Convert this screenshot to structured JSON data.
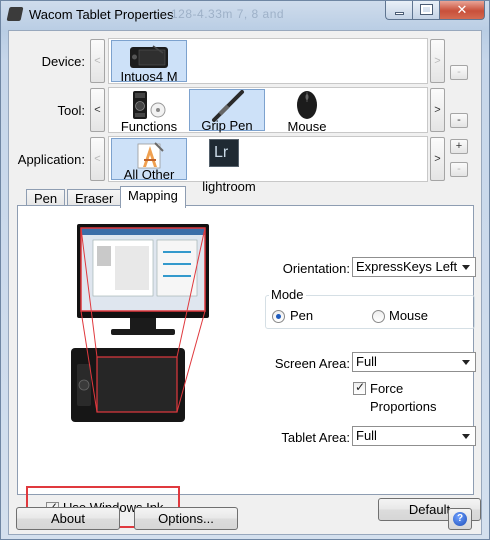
{
  "window": {
    "title": "Wacom Tablet Properties",
    "background_ghost_text": "128-4.33m 7, 8 and",
    "buttons": {
      "minimize": "minimize-icon",
      "maximize": "maximize-icon",
      "close": "✕"
    }
  },
  "rows": {
    "device": {
      "label": "Device:",
      "items": [
        {
          "label": "Intuos4 M",
          "icon": "tablet-icon",
          "selected": true
        }
      ],
      "left_arrow": "<",
      "right_arrow": ">",
      "minus": "-"
    },
    "tool": {
      "label": "Tool:",
      "items": [
        {
          "label": "Functions",
          "icon": "functions-icon",
          "selected": false
        },
        {
          "label": "Grip Pen",
          "icon": "pen-icon",
          "selected": true
        },
        {
          "label": "Mouse",
          "icon": "mouse-icon",
          "selected": false
        }
      ],
      "left_arrow": "<",
      "right_arrow": ">",
      "minus": "-"
    },
    "application": {
      "label": "Application:",
      "items": [
        {
          "label": "All Other",
          "icon": "all-apps-icon",
          "selected": true
        },
        {
          "label": "lightroom",
          "icon": "lightroom-icon",
          "icon_text": "Lr",
          "selected": false
        }
      ],
      "left_arrow": "<",
      "right_arrow": ">",
      "plus": "+",
      "minus": "-"
    }
  },
  "tabs": [
    {
      "label": "Pen",
      "active": false
    },
    {
      "label": "Eraser",
      "active": false
    },
    {
      "label": "Mapping",
      "active": true
    }
  ],
  "mapping": {
    "orientation": {
      "label": "Orientation:",
      "value": "ExpressKeys Left"
    },
    "mode": {
      "legend": "Mode",
      "options": [
        {
          "label": "Pen",
          "selected": true
        },
        {
          "label": "Mouse",
          "selected": false
        }
      ]
    },
    "screen_area": {
      "label": "Screen Area:",
      "value": "Full"
    },
    "force_proportions": {
      "label_line1": "Force",
      "label_line2": "Proportions",
      "checked": true
    },
    "tablet_area": {
      "label": "Tablet Area:",
      "value": "Full"
    },
    "use_windows_ink": {
      "label": "Use Windows Ink",
      "checked": true
    },
    "default_button": "Default"
  },
  "footer": {
    "about_button": "About",
    "options_button": "Options...",
    "help_icon": "?"
  },
  "colors": {
    "selection_bg": "#cde1f8",
    "selection_border": "#7da2ce",
    "annotation_red": "#e0393e",
    "radio_dot": "#1e5bbd"
  }
}
